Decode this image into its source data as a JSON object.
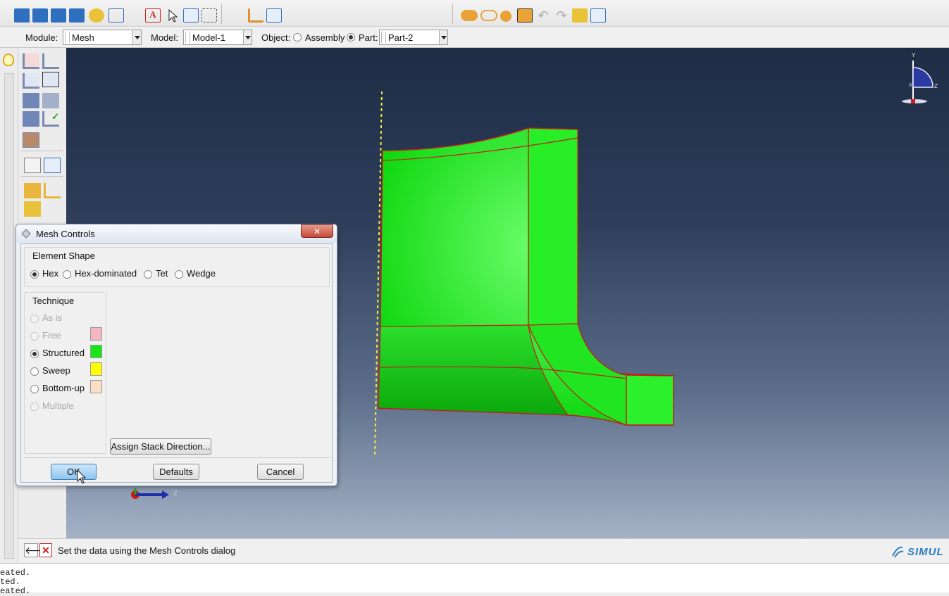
{
  "context_bar": {
    "module_label": "Module:",
    "module_value": "Mesh",
    "model_label": "Model:",
    "model_value": "Model-1",
    "object_label": "Object:",
    "assembly_label": "Assembly",
    "part_label": "Part:",
    "part_value": "Part-2"
  },
  "dialog": {
    "title": "Mesh Controls",
    "close_glyph": "✕",
    "element_shape": {
      "label": "Element Shape",
      "options": [
        "Hex",
        "Hex-dominated",
        "Tet",
        "Wedge"
      ],
      "selected": "Hex"
    },
    "technique": {
      "label": "Technique",
      "options": [
        {
          "label": "As is",
          "enabled": false,
          "color": null
        },
        {
          "label": "Free",
          "enabled": false,
          "color": "#f4b6c2"
        },
        {
          "label": "Structured",
          "enabled": true,
          "color": "#19e619"
        },
        {
          "label": "Sweep",
          "enabled": true,
          "color": "#ffff00"
        },
        {
          "label": "Bottom-up",
          "enabled": true,
          "color": "#fde0c4"
        },
        {
          "label": "Multiple",
          "enabled": false,
          "color": null
        }
      ],
      "selected": "Structured"
    },
    "assign_stack_label": "Assign Stack Direction...",
    "ok_label": "OK",
    "defaults_label": "Defaults",
    "cancel_label": "Cancel"
  },
  "viewport": {
    "triad_x": "X",
    "triad_y": "Y",
    "triad_z": "Z",
    "part_color": "#19e619",
    "edge_color": "#cc1111"
  },
  "prompt": {
    "text": "Set the data using the Mesh Controls dialog",
    "brand": "SIMUL"
  },
  "messages": [
    "eated.",
    "ted.",
    "eated."
  ]
}
